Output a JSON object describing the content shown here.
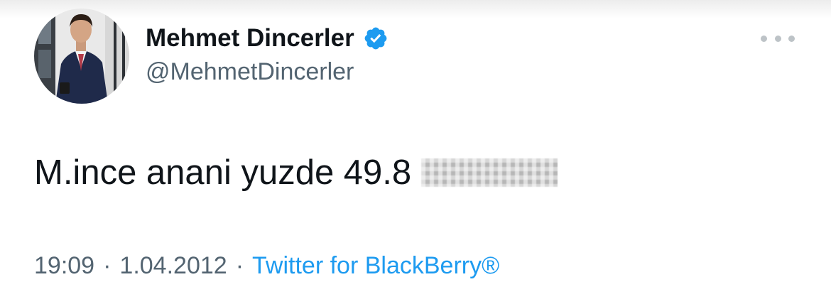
{
  "tweet": {
    "author": {
      "name": "Mehmet Dincerler",
      "handle": "@MehmetDincerler",
      "verified": true,
      "avatar": "profile-photo"
    },
    "text": "M.ince anani yuzde 49.8",
    "text_redacted": true,
    "time": "19:09",
    "date": "1.04.2012",
    "separator": "·",
    "source": "Twitter for BlackBerry®"
  },
  "icons": {
    "verified": "verified-badge-icon",
    "more": "more-options-icon"
  },
  "colors": {
    "link": "#1d9bf0",
    "secondary_text": "#536471",
    "primary_text": "#0f1419",
    "verified_badge": "#1d9bf0"
  }
}
